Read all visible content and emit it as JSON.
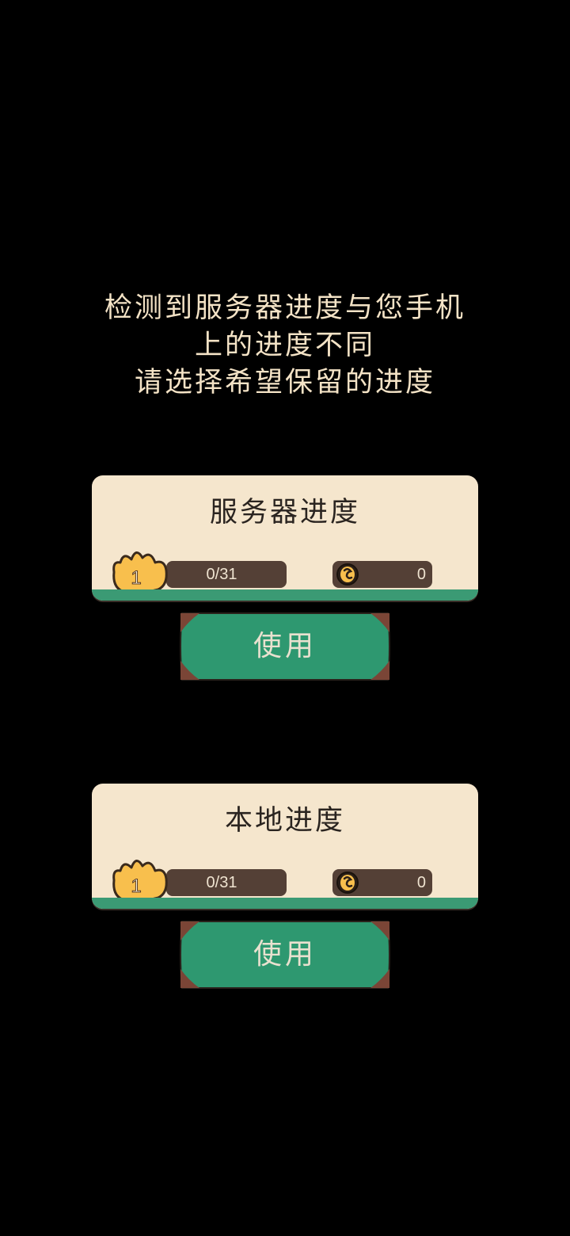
{
  "message": {
    "lines": [
      "检测到服务器进度与您手机",
      "上的进度不同",
      "请选择希望保留的进度"
    ]
  },
  "colors": {
    "background": "#000000",
    "card": "#f5e6cd",
    "accent_green": "#2e9870",
    "bar_brown": "#544036",
    "crown_yellow": "#f8bf4d",
    "message_text": "#f4e3c6"
  },
  "options": [
    {
      "title": "服务器进度",
      "level": "1",
      "progress": "0/31",
      "coins": "0",
      "button_label": "使用"
    },
    {
      "title": "本地进度",
      "level": "1",
      "progress": "0/31",
      "coins": "0",
      "button_label": "使用"
    }
  ],
  "icons": {
    "level": "crown-icon",
    "currency": "coin-icon"
  }
}
